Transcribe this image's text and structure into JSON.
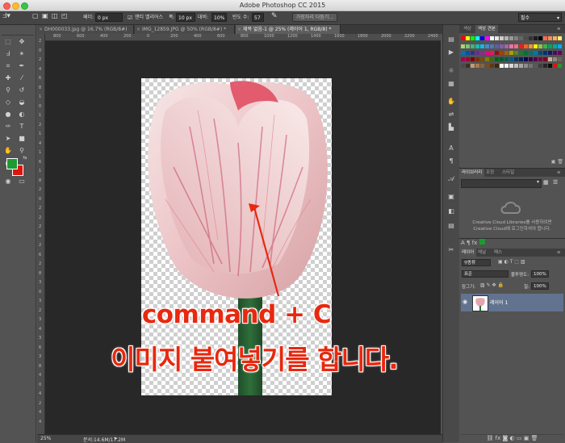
{
  "window": {
    "title": "Adobe Photoshop CC 2015"
  },
  "options_bar": {
    "feather_label": "페더:",
    "feather_value": "0 px",
    "antialias_label": "앤티 앨리어스",
    "width_label": "폭:",
    "width_value": "10 px",
    "contrast_label": "대비:",
    "contrast_value": "10%",
    "frequency_label": "빈도 수:",
    "frequency_value": "57",
    "refine_button": "가장자리 다듬기...",
    "workspace_select": "필수"
  },
  "tabs": [
    {
      "label": "DH000033.jpg @ 16.7% (RGB/8#)",
      "active": false
    },
    {
      "label": "IMG_12859.JPG @ 50% (RGB/8#) *",
      "active": false
    },
    {
      "label": "제목 없음-1 @ 25% (레이어 1, RGB/8) *",
      "active": true
    }
  ],
  "ruler": {
    "h_ticks": [
      "800",
      "600",
      "400",
      "200",
      "0",
      "200",
      "400",
      "600",
      "800",
      "1000",
      "1200",
      "1400",
      "1600",
      "1800",
      "2000",
      "2200",
      "2400",
      "2600",
      "2800"
    ],
    "v_ticks": [
      "2",
      "0",
      "2",
      "4",
      "6",
      "8",
      "1",
      "0",
      "1",
      "2",
      "1",
      "4",
      "1",
      "6",
      "1",
      "8",
      "2",
      "0",
      "2",
      "2",
      "2",
      "4",
      "2",
      "6",
      "2",
      "8",
      "3",
      "0",
      "3",
      "2",
      "3",
      "4",
      "3",
      "6",
      "3",
      "8",
      "4",
      "0",
      "4",
      "2",
      "4",
      "4"
    ]
  },
  "status": {
    "zoom": "25%",
    "doc_info": "문서:14.6M/17.2M"
  },
  "swatches_panel": {
    "tabs": [
      "색상",
      "색상 견본"
    ],
    "active_tab": 1
  },
  "libraries_panel": {
    "tabs": [
      "라이브러리",
      "조정",
      "스타일"
    ],
    "message_line1": "Creative Cloud Libraries를 사용하려면",
    "message_line2": "Creative Cloud에 로그인하셔야 합니다."
  },
  "layers_panel": {
    "tabs": [
      "레이어",
      "채널",
      "패스"
    ],
    "filter_label": "종류",
    "blend_mode": "표준",
    "opacity_label": "불투명도:",
    "opacity_value": "100%",
    "lock_label": "잠그기:",
    "fill_label": "칠:",
    "fill_value": "100%",
    "layers": [
      {
        "name": "레이어 1",
        "visible": true
      }
    ]
  },
  "annotation": {
    "line1": "command + C",
    "line2": "이미지 붙여넣기를 합니다."
  },
  "colors": {
    "foreground": "#1e9a32",
    "background": "#e0140e",
    "annotation": "#e8280f"
  }
}
